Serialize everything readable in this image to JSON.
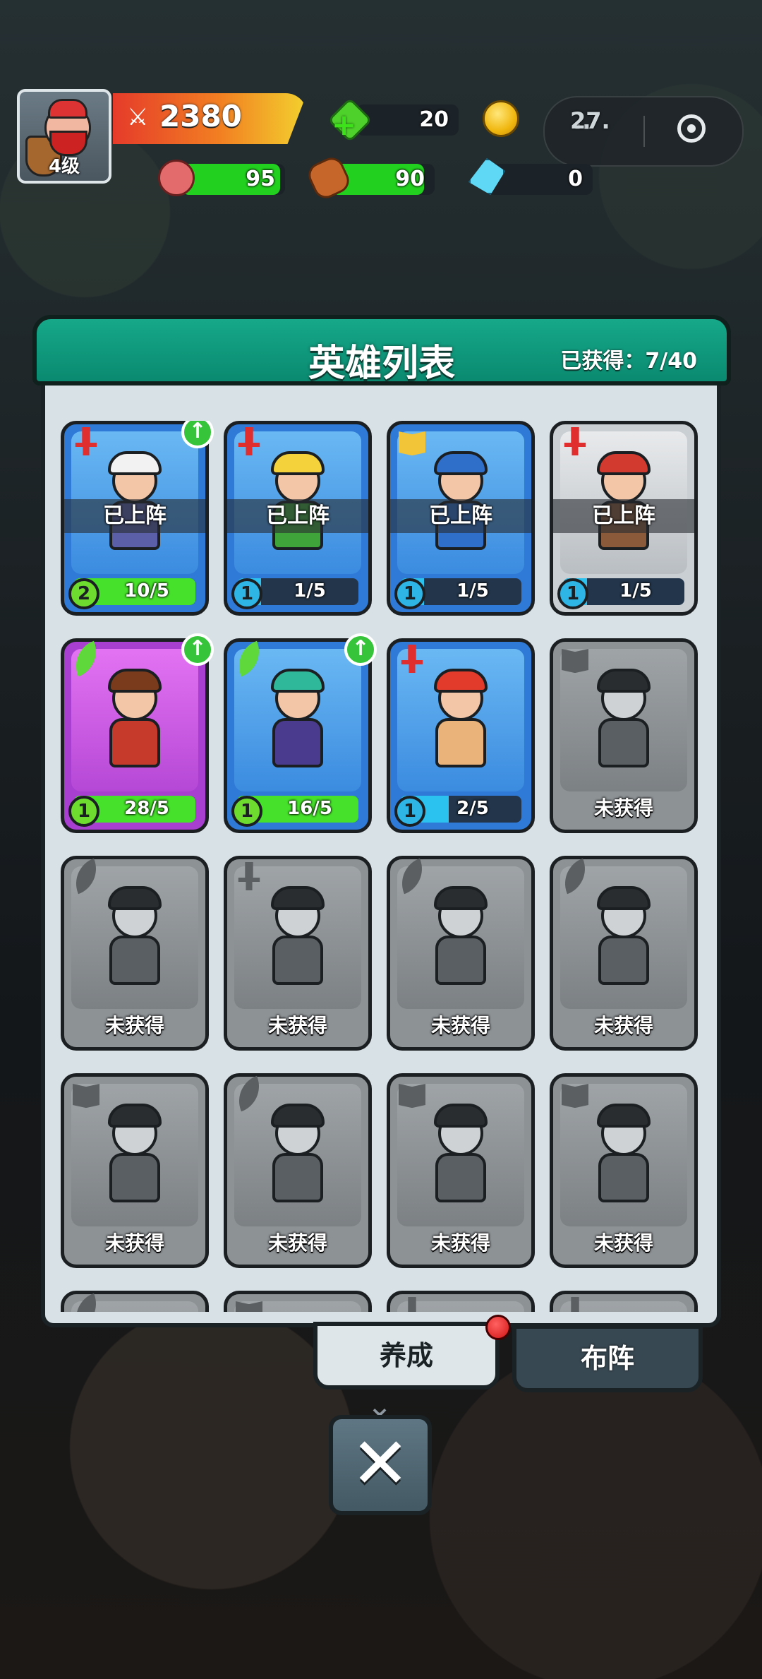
{
  "player": {
    "level_label": "4级",
    "power": "2380"
  },
  "resources": {
    "green_gem": "20",
    "gold": "27.",
    "meat": "95",
    "wood": "90",
    "crystal": "0",
    "meat_fill": 0.95,
    "wood_fill": 0.9
  },
  "capsule": {
    "menu_glyph": "··"
  },
  "panel": {
    "title": "英雄列表",
    "obtained": "已获得：7/40"
  },
  "heroes": [
    {
      "status": "已上阵",
      "level": "2",
      "progress": "10/5",
      "cls": "sword",
      "upgrade": true,
      "theme": "blue",
      "fill": 1.0,
      "colors": {
        "hair": "#f2f2f2",
        "body": "#5a5fa8"
      }
    },
    {
      "status": "已上阵",
      "level": "1",
      "progress": "1/5",
      "cls": "sword",
      "upgrade": false,
      "theme": "blue",
      "fill": 0.2,
      "colors": {
        "hair": "#f4d23b",
        "body": "#3fa53a"
      }
    },
    {
      "status": "已上阵",
      "level": "1",
      "progress": "1/5",
      "cls": "book",
      "upgrade": false,
      "theme": "blue",
      "fill": 0.2,
      "colors": {
        "hair": "#2f6ec9",
        "body": "#2f6ec9"
      }
    },
    {
      "status": "已上阵",
      "level": "1",
      "progress": "1/5",
      "cls": "sword",
      "upgrade": false,
      "theme": "gray",
      "fill": 0.2,
      "colors": {
        "hair": "#d33a2f",
        "body": "#8b5a3a"
      }
    },
    {
      "status": "",
      "level": "1",
      "progress": "28/5",
      "cls": "leaf",
      "upgrade": true,
      "theme": "purple",
      "fill": 1.0,
      "colors": {
        "hair": "#7a3b1c",
        "body": "#c53a2a"
      }
    },
    {
      "status": "",
      "level": "1",
      "progress": "16/5",
      "cls": "leaf",
      "upgrade": true,
      "theme": "blue",
      "fill": 1.0,
      "colors": {
        "hair": "#2fb89a",
        "body": "#4a3b8f"
      }
    },
    {
      "status": "",
      "level": "1",
      "progress": "2/5",
      "cls": "sword",
      "upgrade": false,
      "theme": "blue",
      "fill": 0.4,
      "colors": {
        "hair": "#e23b2b",
        "body": "#e9b37a"
      }
    },
    {
      "status": "未获得",
      "cls": "book",
      "theme": "locked"
    },
    {
      "status": "未获得",
      "cls": "leaf",
      "theme": "locked"
    },
    {
      "status": "未获得",
      "cls": "sword",
      "theme": "locked"
    },
    {
      "status": "未获得",
      "cls": "leaf",
      "theme": "locked"
    },
    {
      "status": "未获得",
      "cls": "leaf",
      "theme": "locked"
    },
    {
      "status": "未获得",
      "cls": "book",
      "theme": "locked"
    },
    {
      "status": "未获得",
      "cls": "leaf",
      "theme": "locked"
    },
    {
      "status": "未获得",
      "cls": "book",
      "theme": "locked"
    },
    {
      "status": "未获得",
      "cls": "book",
      "theme": "locked"
    },
    {
      "status": "",
      "cls": "leaf",
      "theme": "locked"
    },
    {
      "status": "",
      "cls": "book",
      "theme": "locked"
    },
    {
      "status": "",
      "cls": "sword",
      "theme": "locked"
    },
    {
      "status": "",
      "cls": "sword",
      "theme": "locked"
    }
  ],
  "tabs": {
    "cultivate": "养成",
    "formation": "布阵"
  },
  "close_glyph": "✕",
  "chevron_glyph": "⌄"
}
